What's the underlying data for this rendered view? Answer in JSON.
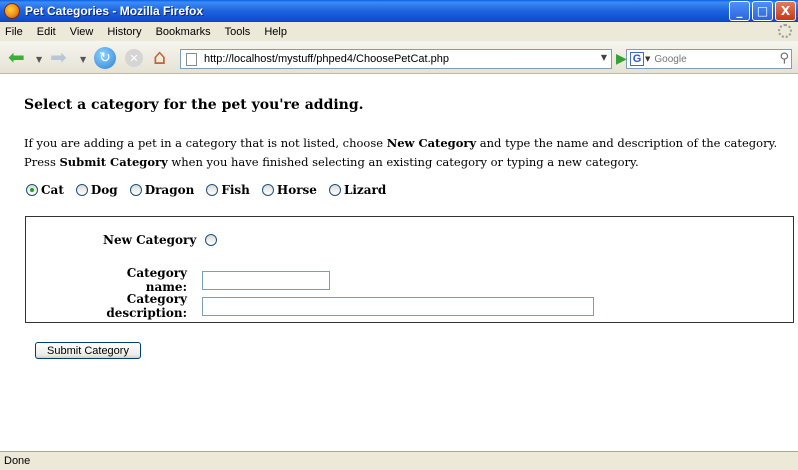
{
  "window": {
    "title": "Pet Categories - Mozilla Firefox",
    "buttons": {
      "minimize": "_",
      "maximize": "□",
      "close": "X"
    }
  },
  "menubar": {
    "items": [
      "File",
      "Edit",
      "View",
      "History",
      "Bookmarks",
      "Tools",
      "Help"
    ]
  },
  "navbar": {
    "url": "http://localhost/mystuff/phped4/ChoosePetCat.php",
    "search_placeholder": "Google",
    "search_engine_letter": "G"
  },
  "page": {
    "heading": "Select a category for the pet you're adding.",
    "intro": {
      "part1": "If you are adding a pet in a category that is not listed, choose ",
      "bold1": "New Category",
      "part2": " and type the name and description of the category. Press ",
      "bold2": "Submit Category",
      "part3": " when you have finished selecting an existing category or typing a new category."
    },
    "categories": [
      "Cat",
      "Dog",
      "Dragon",
      "Fish",
      "Horse",
      "Lizard"
    ],
    "selected_category": "Cat",
    "new_category_label": "New Category",
    "category_name_label": "Category name:",
    "category_name_value": "",
    "category_description_label": "Category description:",
    "category_description_value": "",
    "submit_label": "Submit Category"
  },
  "statusbar": {
    "text": "Done"
  }
}
